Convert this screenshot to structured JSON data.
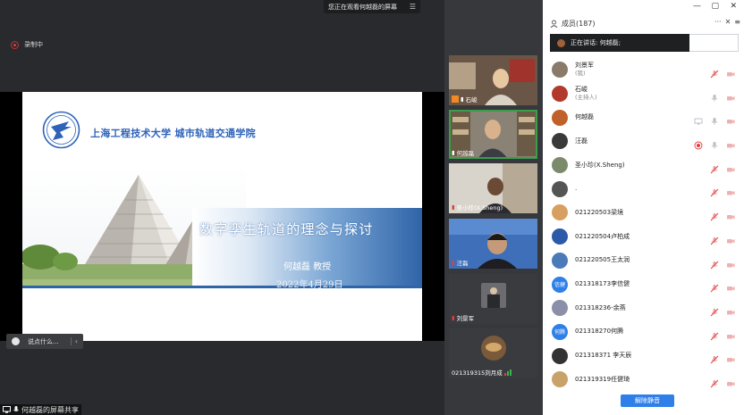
{
  "banner": {
    "text": "您正在观看何越磊的屏幕",
    "menu_icon": "list-icon"
  },
  "recording": {
    "label": "录制中"
  },
  "slide": {
    "university": "上海工程技术大学 城市轨道交通学院",
    "title": "数字孪生轨道的理念与探讨",
    "author": "何越磊 教授",
    "date": "2022年4月29日",
    "colors": {
      "blue": "#2f64a8",
      "band_light": "#dce8f4"
    }
  },
  "comment": {
    "placeholder": "说点什么..."
  },
  "share_label": "何越磊的屏幕共享",
  "tiles": [
    {
      "name": "石峻",
      "icons": [
        "person-icon",
        "mic-icon"
      ]
    },
    {
      "name": "何越磊",
      "icons": [
        "mic-icon"
      ]
    },
    {
      "name": "圣小珍(X.Sheng)",
      "icons": [
        "mic-off-icon"
      ]
    },
    {
      "name": "汪磊",
      "icons": [
        "mic-off-icon"
      ]
    },
    {
      "name": "刘景军",
      "icons": [
        "mic-off-icon"
      ]
    },
    {
      "name": "021319315刘月成",
      "icons": [
        "signal-icon"
      ]
    }
  ],
  "panel": {
    "title": "成员(187)",
    "speaking": "正在讲话: 何越磊;",
    "unmute_all": "解除静音",
    "members": [
      {
        "name": "刘景军",
        "sub": "(我)",
        "avatar_text": "",
        "avatar_color": "#8a7a6a",
        "icons": [
          "mic-off",
          "cam-off"
        ]
      },
      {
        "name": "石峻",
        "sub": "(主持人)",
        "avatar_text": "",
        "avatar_color": "#b23a2c",
        "icons": [
          "mic-on",
          "cam-off"
        ]
      },
      {
        "name": "何越磊",
        "sub": "",
        "avatar_text": "",
        "avatar_color": "#c0602a",
        "icons": [
          "share",
          "mic-on",
          "cam-off"
        ]
      },
      {
        "name": "汪磊",
        "sub": "",
        "avatar_text": "",
        "avatar_color": "#3a3a3a",
        "icons": [
          "rec",
          "mic-on",
          "cam-off"
        ]
      },
      {
        "name": "圣小珍(X.Sheng)",
        "sub": "",
        "avatar_text": "",
        "avatar_color": "#7a8a6a",
        "icons": [
          "mic-off",
          "cam-off"
        ]
      },
      {
        "name": ".",
        "sub": "",
        "avatar_text": "",
        "avatar_color": "#555",
        "icons": [
          "mic-off",
          "cam-off"
        ]
      },
      {
        "name": "021220503梁境",
        "sub": "",
        "avatar_text": "",
        "avatar_color": "#d8a060",
        "icons": [
          "mic-off",
          "cam-off"
        ]
      },
      {
        "name": "021220504卢柏成",
        "sub": "",
        "avatar_text": "",
        "avatar_color": "#2b5aa8",
        "icons": [
          "mic-off",
          "cam-off"
        ]
      },
      {
        "name": "021220505王太润",
        "sub": "",
        "avatar_text": "",
        "avatar_color": "#4a7ab8",
        "icons": [
          "mic-off",
          "cam-off"
        ]
      },
      {
        "name": "021318173李信健",
        "sub": "",
        "avatar_text": "信健",
        "avatar_color": "#2f7fe8",
        "icons": [
          "mic-off",
          "cam-off"
        ]
      },
      {
        "name": "021318236-余燕",
        "sub": "",
        "avatar_text": "",
        "avatar_color": "#8c8fa8",
        "icons": [
          "mic-off",
          "cam-off"
        ]
      },
      {
        "name": "021318270何腾",
        "sub": "",
        "avatar_text": "何腾",
        "avatar_color": "#2f7fe8",
        "icons": [
          "mic-off",
          "cam-off"
        ]
      },
      {
        "name": "021318371 李天辰",
        "sub": "",
        "avatar_text": "",
        "avatar_color": "#333",
        "icons": [
          "mic-off",
          "cam-off"
        ]
      },
      {
        "name": "021319319任健琦",
        "sub": "",
        "avatar_text": "",
        "avatar_color": "#c9a26a",
        "icons": [
          "mic-off",
          "cam-off"
        ]
      }
    ]
  }
}
